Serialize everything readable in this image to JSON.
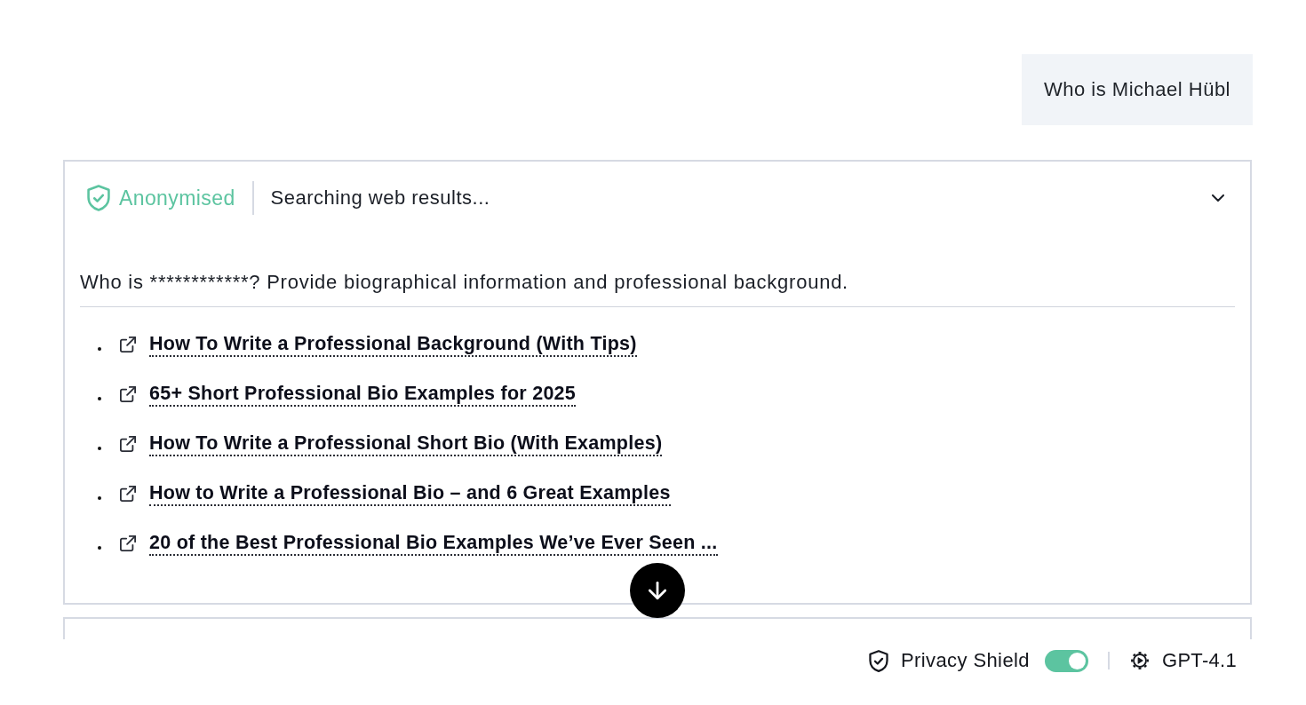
{
  "user_message": {
    "text": "Who is Michael Hübl"
  },
  "search_panel": {
    "badge": "Anonymised",
    "status": "Searching web results...",
    "expanded": true,
    "query": "Who is ************? Provide biographical information and professional background.",
    "results": [
      {
        "title": "How To Write a Professional Background (With Tips)"
      },
      {
        "title": "65+ Short Professional Bio Examples for 2025"
      },
      {
        "title": "How To Write a Professional Short Bio (With Examples)"
      },
      {
        "title": "How to Write a Professional Bio – and 6 Great Examples"
      },
      {
        "title": "20 of the Best Professional Bio Examples We’ve Ever Seen ..."
      }
    ]
  },
  "footer": {
    "privacy_shield": {
      "label": "Privacy Shield",
      "on": true
    },
    "model": "GPT-4.1"
  }
}
